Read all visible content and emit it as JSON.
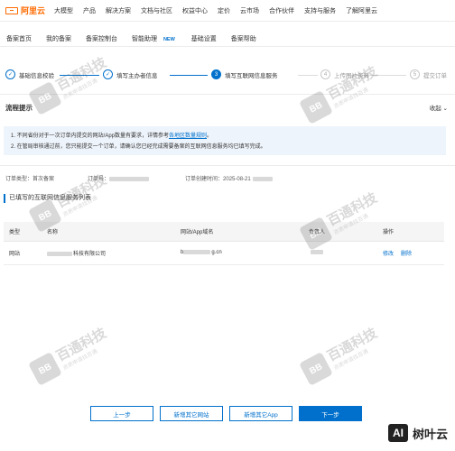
{
  "brand": {
    "name": "阿里云",
    "color": "#ff6a00"
  },
  "topnav": [
    "大模型",
    "产品",
    "解决方案",
    "文档与社区",
    "权益中心",
    "定价",
    "云市场",
    "合作伙伴",
    "支持与服务",
    "了解阿里云"
  ],
  "subnav": {
    "items": [
      "备案首页",
      "我的备案",
      "备案控制台"
    ],
    "assistant": "智能助理",
    "new_badge": "NEW",
    "rest": [
      "基础设置",
      "备案帮助"
    ]
  },
  "steps": [
    {
      "label": "基础信息校验",
      "state": "done",
      "mark": "✓"
    },
    {
      "label": "填写主办者信息",
      "state": "done",
      "mark": "✓"
    },
    {
      "label": "填写互联网信息服务",
      "state": "active",
      "mark": "3"
    },
    {
      "label": "上传图片资料",
      "state": "todo",
      "mark": "4"
    },
    {
      "label": "提交订单",
      "state": "todo",
      "mark": "5"
    }
  ],
  "tip": {
    "title": "流程提示",
    "collapse": "收起",
    "line1_prefix": "1. 不同省份对于一次订单内提交的网站/App数量有要求，详情参考",
    "line1_link": "各地区数量规则",
    "line1_suffix": "。",
    "line2": "2. 在管局审核通过前，您只能提交一个订单，请确认您已经完成需要备案的互联网信息服务均已填写完成。"
  },
  "order": {
    "type_label": "订单类型：",
    "type_value": "首次备案",
    "no_label": "订单号：",
    "time_label": "订单创建时间：",
    "time_value": "2025-08-21"
  },
  "section_title": "已填写的互联网信息服务列表",
  "table": {
    "headers": [
      "类型",
      "名称",
      "网站/App域名",
      "负责人",
      "操作"
    ],
    "rows": [
      {
        "type": "网站",
        "name_suffix": "科技有限公司",
        "domain_prefix": "b",
        "domain_suffix": "g.cn",
        "edit": "修改",
        "del": "删除"
      }
    ]
  },
  "buttons": {
    "prev": "上一步",
    "add_site": "新增其它网站",
    "add_app": "新增其它App",
    "next": "下一步"
  },
  "watermark": {
    "logo": "BB",
    "text": "百通科技",
    "sub": "资质申请找百通"
  },
  "corner": {
    "ai": "AI",
    "text": "树叶云"
  },
  "colors": {
    "accent": "#0070cc",
    "tip_bg": "#eef4fb"
  }
}
